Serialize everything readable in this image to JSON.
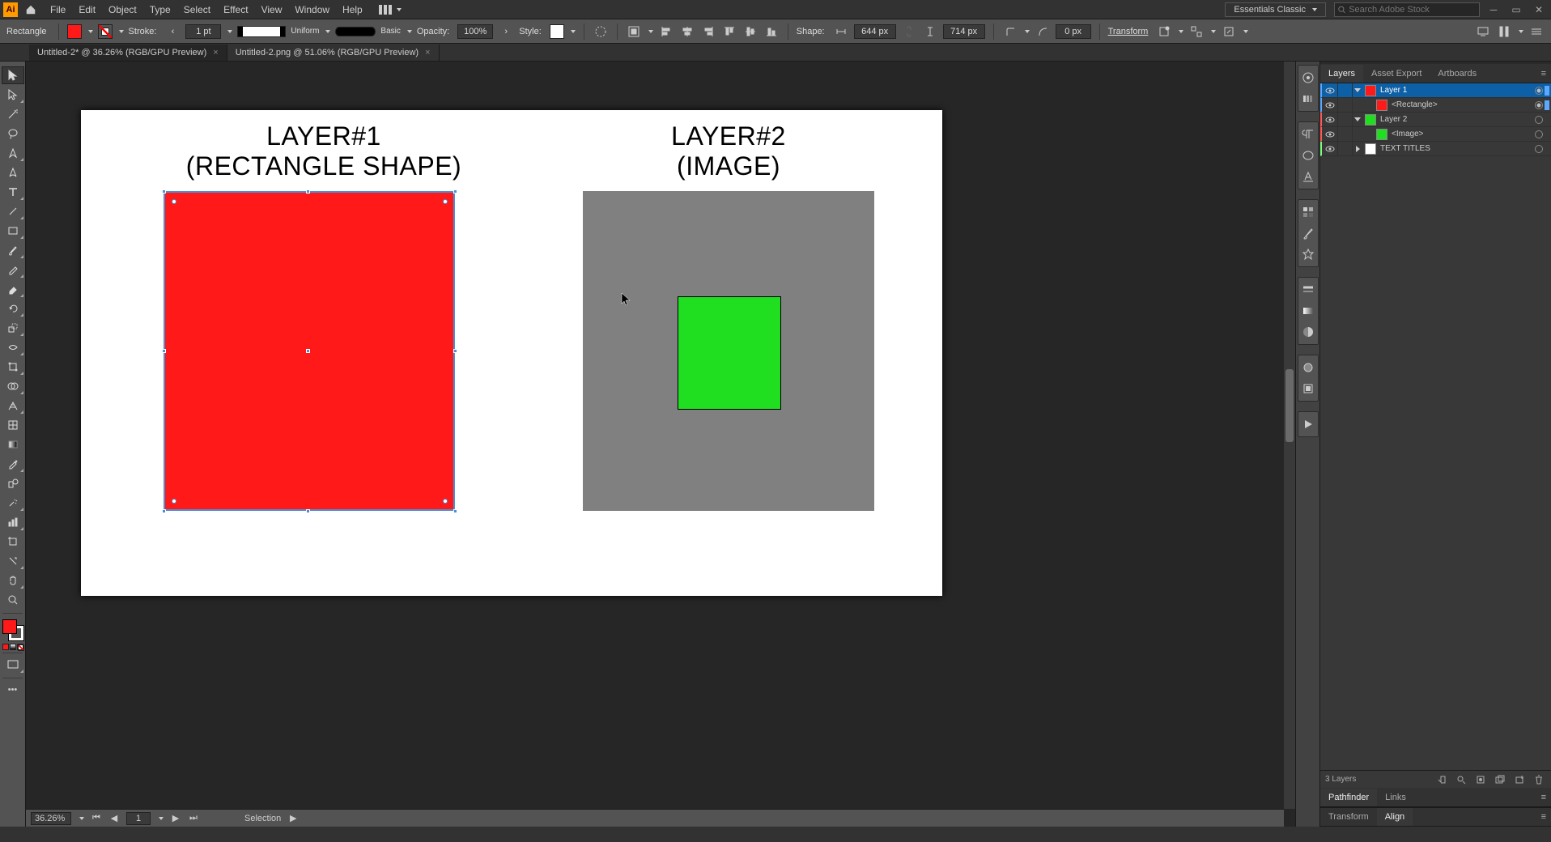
{
  "menu": {
    "items": [
      "File",
      "Edit",
      "Object",
      "Type",
      "Select",
      "Effect",
      "View",
      "Window",
      "Help"
    ]
  },
  "workspace": {
    "label": "Essentials Classic"
  },
  "search": {
    "placeholder": "Search Adobe Stock"
  },
  "control": {
    "shape_label": "Rectangle",
    "stroke_label": "Stroke:",
    "stroke_value": "1 pt",
    "profile_label": "Uniform",
    "brush_label": "Basic",
    "opacity_label": "Opacity:",
    "opacity_value": "100%",
    "style_label": "Style:",
    "shape_prop_label": "Shape:",
    "width_value": "644 px",
    "height_value": "714 px",
    "corner_value": "0 px",
    "transform_label": "Transform"
  },
  "tabs": [
    {
      "label": "Untitled-2* @ 36.26% (RGB/GPU Preview)",
      "active": true
    },
    {
      "label": "Untitled-2.png @ 51.06% (RGB/GPU Preview)",
      "active": false
    }
  ],
  "canvas": {
    "title1_a": "LAYER#1",
    "title1_b": "(RECTANGLE SHAPE)",
    "title2_a": "LAYER#2",
    "title2_b": "(IMAGE)"
  },
  "layers_panel": {
    "tabs": [
      "Layers",
      "Asset Export",
      "Artboards"
    ],
    "rows": [
      {
        "name": "Layer 1",
        "thumb": "#ff1919",
        "color": "#5aa8ff",
        "selected": true,
        "depth": 0,
        "twisty": "open",
        "sel": "#5aa8ff",
        "target": true
      },
      {
        "name": "<Rectangle>",
        "thumb": "#ff1919",
        "color": "#5aa8ff",
        "selected": false,
        "depth": 1,
        "twisty": "none",
        "sel": "#5aa8ff",
        "target": true
      },
      {
        "name": "Layer 2",
        "thumb": "#20df20",
        "color": "#ff5a5a",
        "selected": false,
        "depth": 0,
        "twisty": "open",
        "sel": "",
        "target": false
      },
      {
        "name": "<Image>",
        "thumb": "#20df20",
        "color": "#ff5a5a",
        "selected": false,
        "depth": 1,
        "twisty": "none",
        "sel": "",
        "target": false
      },
      {
        "name": "TEXT TITLES",
        "thumb": "#ffffff",
        "color": "#7cff7c",
        "selected": false,
        "depth": 0,
        "twisty": "closed",
        "sel": "",
        "target": false
      }
    ],
    "footer": "3 Layers"
  },
  "bottom_tabs1": [
    "Pathfinder",
    "Links"
  ],
  "bottom_tabs2": [
    "Transform",
    "Align"
  ],
  "status": {
    "zoom": "36.26%",
    "artboard": "1",
    "tool": "Selection"
  }
}
